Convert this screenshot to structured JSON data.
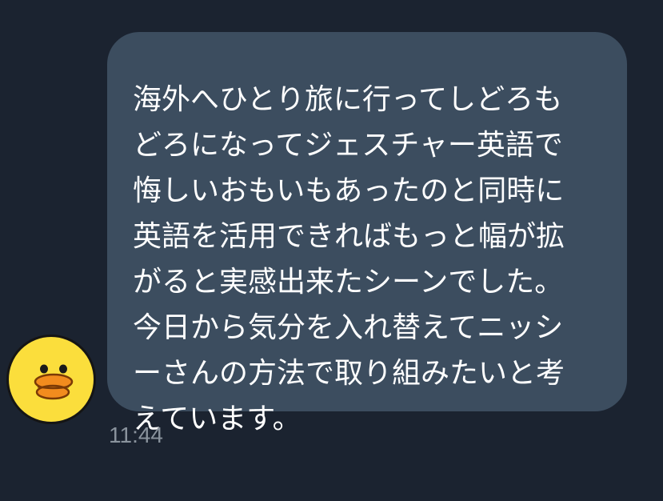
{
  "chat": {
    "message": {
      "lines": [
        "海外へひとり旅に行ってしどろも",
        "どろになってジェスチャー英語で",
        "悔しいおもいもあったのと同時に",
        "英語を活用できればもっと幅が拡",
        "がると実感出来たシーンでした。",
        "今日から気分を入れ替えてニッシ",
        "ーさんの方法で取り組みたいと考",
        "えています。"
      ],
      "time": "11:44"
    },
    "sender": {
      "avatar_icon": "duck-sally-icon"
    }
  },
  "colors": {
    "background": "#1b2330",
    "bubble": "#3c4d5f",
    "text": "#ffffff",
    "timestamp": "#8a939d",
    "avatar_yellow": "#fbde3c",
    "avatar_beak": "#f28c1e"
  }
}
